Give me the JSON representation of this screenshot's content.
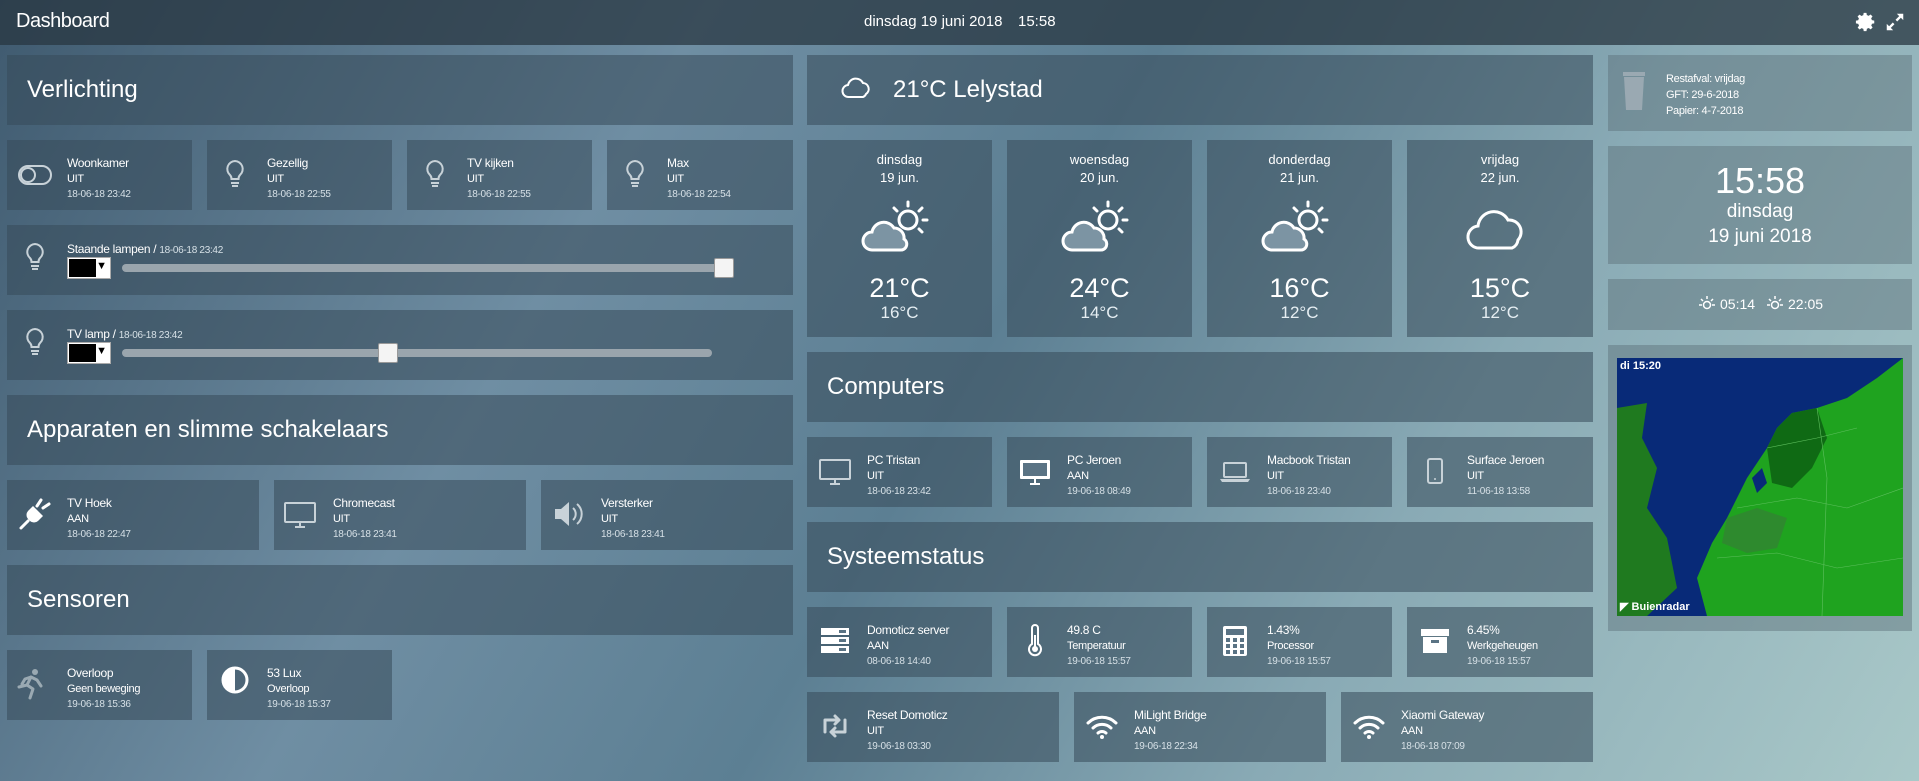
{
  "topbar": {
    "title": "Dashboard",
    "date": "dinsdag 19 juni 2018",
    "time": "15:58",
    "icons": [
      "gear-icon",
      "fullscreen-icon"
    ]
  },
  "lighting": {
    "header": "Verlichting",
    "tiles": [
      {
        "name": "Woonkamer",
        "state": "UIT",
        "ts": "18-06-18 23:42",
        "icon": "toggle-icon"
      },
      {
        "name": "Gezellig",
        "state": "UIT",
        "ts": "18-06-18 22:55",
        "icon": "bulb-icon"
      },
      {
        "name": "TV kijken",
        "state": "UIT",
        "ts": "18-06-18 22:55",
        "icon": "bulb-icon"
      },
      {
        "name": "Max",
        "state": "UIT",
        "ts": "18-06-18 22:54",
        "icon": "bulb-icon"
      }
    ],
    "dimmers": [
      {
        "name": "Staande lampen /",
        "ts": "18-06-18 23:42",
        "level": 1.0
      },
      {
        "name": "TV lamp /",
        "ts": "18-06-18 23:42",
        "level": 0.45
      }
    ]
  },
  "devices": {
    "header": "Apparaten en slimme schakelaars",
    "tiles": [
      {
        "name": "TV Hoek",
        "state": "AAN",
        "ts": "18-06-18 22:47",
        "icon": "plug-icon"
      },
      {
        "name": "Chromecast",
        "state": "UIT",
        "ts": "18-06-18 23:41",
        "icon": "monitor-icon"
      },
      {
        "name": "Versterker",
        "state": "UIT",
        "ts": "18-06-18 23:41",
        "icon": "speaker-icon"
      }
    ]
  },
  "sensors": {
    "header": "Sensoren",
    "tiles": [
      {
        "name": "Overloop",
        "state": "Geen beweging",
        "ts": "19-06-18 15:36",
        "icon": "motion-icon"
      },
      {
        "name": "53 Lux",
        "state": "Overloop",
        "ts": "19-06-18 15:37",
        "icon": "contrast-icon"
      }
    ]
  },
  "weather": {
    "current": "21°C  Lelystad",
    "days": [
      {
        "d1": "dinsdag",
        "d2": "19 jun.",
        "hi": "21°C",
        "lo": "16°C",
        "icon": "partly-cloudy-icon"
      },
      {
        "d1": "woensdag",
        "d2": "20 jun.",
        "hi": "24°C",
        "lo": "14°C",
        "icon": "partly-cloudy-icon"
      },
      {
        "d1": "donderdag",
        "d2": "21 jun.",
        "hi": "16°C",
        "lo": "12°C",
        "icon": "partly-cloudy-icon"
      },
      {
        "d1": "vrijdag",
        "d2": "22 jun.",
        "hi": "15°C",
        "lo": "12°C",
        "icon": "cloud-icon"
      }
    ]
  },
  "computers": {
    "header": "Computers",
    "tiles": [
      {
        "name": "PC Tristan",
        "state": "UIT",
        "ts": "18-06-18 23:42",
        "icon": "desktop-icon"
      },
      {
        "name": "PC Jeroen",
        "state": "AAN",
        "ts": "19-06-18 08:49",
        "icon": "desktop-icon"
      },
      {
        "name": "Macbook Tristan",
        "state": "UIT",
        "ts": "18-06-18 23:40",
        "icon": "laptop-icon"
      },
      {
        "name": "Surface Jeroen",
        "state": "UIT",
        "ts": "11-06-18 13:58",
        "icon": "tablet-icon"
      }
    ]
  },
  "system": {
    "header": "Systeemstatus",
    "tiles": [
      {
        "name": "Domoticz server",
        "state": "AAN",
        "ts": "08-06-18 14:40",
        "icon": "server-icon"
      },
      {
        "name": "49.8 C",
        "state": "Temperatuur",
        "ts": "19-06-18 15:57",
        "icon": "thermometer-icon"
      },
      {
        "name": "1.43%",
        "state": "Processor",
        "ts": "19-06-18 15:57",
        "icon": "calculator-icon"
      },
      {
        "name": "6.45%",
        "state": "Werkgeheugen",
        "ts": "19-06-18 15:57",
        "icon": "archive-icon"
      }
    ],
    "tiles2": [
      {
        "name": "Reset Domoticz",
        "state": "UIT",
        "ts": "19-06-18 03:30",
        "icon": "retweet-icon"
      },
      {
        "name": "MiLight Bridge",
        "state": "AAN",
        "ts": "19-06-18 22:34",
        "icon": "wifi-icon"
      },
      {
        "name": "Xiaomi Gateway",
        "state": "AAN",
        "ts": "18-06-18 07:09",
        "icon": "wifi-icon"
      }
    ]
  },
  "waste": {
    "line1": "Restafval: vrijdag",
    "line2": "GFT: 29-6-2018",
    "line3": "Papier: 4-7-2018",
    "icon": "trash-icon"
  },
  "clock": {
    "time": "15:58",
    "day": "dinsdag",
    "date": "19 juni 2018"
  },
  "sun": {
    "rise": "05:14",
    "set": "22:05"
  },
  "radar": {
    "label": "di 15:20",
    "brand": "Buienradar"
  }
}
